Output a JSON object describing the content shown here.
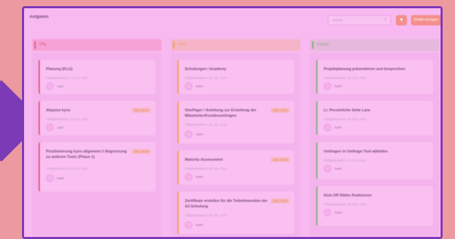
{
  "header": {
    "title": "Aufgaben",
    "search_placeholder": "Suche",
    "primary_button_label": "Detailt anzeigen"
  },
  "columns": [
    {
      "label": "Offig",
      "color": "#e4587a",
      "cards": [
        {
          "name": "Planung (KLG)",
          "due": "Fälligkeitsdatum: 14 Jun, 2024",
          "assignee": "Lara",
          "badge": ""
        },
        {
          "name": "Akquise kyns",
          "due": "Fälligkeitsdatum: 14 Jun, 2024",
          "assignee": "Lara",
          "badge": "ZEIL: 28.04"
        },
        {
          "name": "Positionierung kyns allgemein // Abgrenzung zu anderen Tools (Phase 1)",
          "due": "Fälligkeitsdatum: 26 Jun, 2024",
          "assignee": "Karin",
          "badge": "ZEIL: 28.04"
        }
      ]
    },
    {
      "label": "Offen",
      "color": "#f0a058",
      "cards": [
        {
          "name": "Schulungen / Academy",
          "due": "Fälligkeitsdatum: 28 Jun, 2024",
          "assignee": "Karin",
          "badge": ""
        },
        {
          "name": "OnePager / Anleitung zur Erstellung der Mitarbeiter/Kundenumfragen",
          "due": "Fälligkeitsdatum: 28 Jun, 2024",
          "assignee": "Karin",
          "badge": "ZEIL: 28.04"
        },
        {
          "name": "Maturity Assessment",
          "due": "Fälligkeitsdatum: 28 Jun, 2024",
          "assignee": "Karin",
          "badge": "ZEIL: 28.04"
        },
        {
          "name": "Zertifikate erstellen für die Teilnehmenden der A3 Schulung",
          "due": "Fälligkeitsdatum: 28 Jun, 2024",
          "assignee": "Karin",
          "badge": "ZEIL: 28.04"
        }
      ]
    },
    {
      "label": "Erledigt",
      "color": "#7fb07c",
      "cards": [
        {
          "name": "Projektplanung präsentieren und besprechen",
          "due": "Fälligkeitsdatum: 28 Feb, 2024",
          "assignee": "Karin",
          "badge": ""
        },
        {
          "name": "Li: Persönliche Seite Lara",
          "due": "Fälligkeitsdatum: 16 Feb, 2024",
          "assignee": "Karin",
          "badge": ""
        },
        {
          "name": "Umfragen in Umfrage-Tool abbilden",
          "due": "Fälligkeitsdatum: 21 Feb, 2024",
          "assignee": "Karin",
          "badge": ""
        },
        {
          "name": "Kick-Off Slides finalisieren",
          "due": "Fälligkeitsdatum: 28 Feb, 2024",
          "assignee": "Karin",
          "badge": ""
        }
      ]
    }
  ]
}
